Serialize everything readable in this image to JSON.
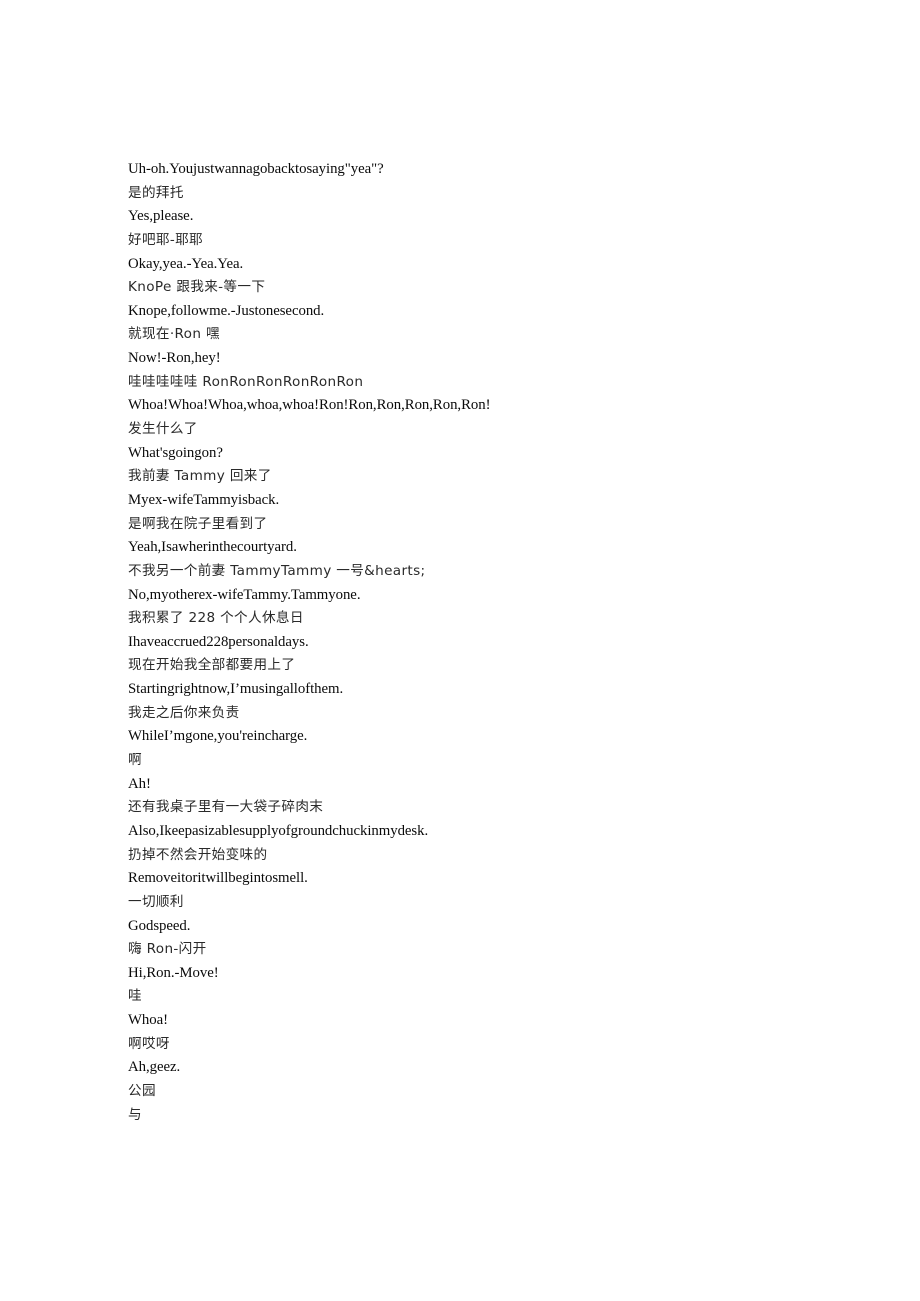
{
  "document": {
    "type": "bilingual-subtitle-transcript",
    "background_color": "#ffffff",
    "text_color": "#000000",
    "source_language": "zh",
    "target_language": "en"
  },
  "lines": [
    {
      "lang": "en",
      "text": "Uh-oh.Youjustwannagobacktosaying\"yea\"?"
    },
    {
      "lang": "zh",
      "text": "是的拜托"
    },
    {
      "lang": "en",
      "text": "Yes,please."
    },
    {
      "lang": "zh",
      "text": "好吧耶-耶耶"
    },
    {
      "lang": "en",
      "text": "Okay,yea.-Yea.Yea."
    },
    {
      "lang": "zh",
      "text": "KnoPe 跟我来-等一下"
    },
    {
      "lang": "en",
      "text": "Knope,followme.-Justonesecond."
    },
    {
      "lang": "zh",
      "text": "就现在·Ron 嘿"
    },
    {
      "lang": "en",
      "text": "Now!-Ron,hey!"
    },
    {
      "lang": "zh",
      "text": "哇哇哇哇哇 RonRonRonRonRonRon"
    },
    {
      "lang": "en",
      "text": "Whoa!Whoa!Whoa,whoa,whoa!Ron!Ron,Ron,Ron,Ron,Ron!"
    },
    {
      "lang": "zh",
      "text": "发生什么了"
    },
    {
      "lang": "en",
      "text": "What'sgoingon?"
    },
    {
      "lang": "zh",
      "text": "我前妻 Tammy 回来了"
    },
    {
      "lang": "en",
      "text": "Myex-wifeTammyisback."
    },
    {
      "lang": "zh",
      "text": "是啊我在院子里看到了"
    },
    {
      "lang": "en",
      "text": "Yeah,Isawherinthecourtyard."
    },
    {
      "lang": "zh",
      "text": "不我另一个前妻 TammyTammy 一号&hearts;"
    },
    {
      "lang": "en",
      "text": "No,myotherex-wifeTammy.Tammyone."
    },
    {
      "lang": "zh",
      "text": "我积累了 228 个个人休息日"
    },
    {
      "lang": "en",
      "text": "Ihaveaccrued228personaldays."
    },
    {
      "lang": "zh",
      "text": "现在开始我全部都要用上了"
    },
    {
      "lang": "en",
      "text": "Startingrightnow,I’musingallofthem."
    },
    {
      "lang": "zh",
      "text": "我走之后你来负责"
    },
    {
      "lang": "en",
      "text": "WhileI’mgone,you'reincharge."
    },
    {
      "lang": "zh",
      "text": "啊"
    },
    {
      "lang": "en",
      "text": "Ah!"
    },
    {
      "lang": "zh",
      "text": "还有我桌子里有一大袋子碎肉末"
    },
    {
      "lang": "en",
      "text": "Also,Ikeepasizablesupplyofgroundchuckinmydesk."
    },
    {
      "lang": "zh",
      "text": "扔掉不然会开始变味的"
    },
    {
      "lang": "en",
      "text": "Removeitoritwillbegintosmell."
    },
    {
      "lang": "zh",
      "text": "一切顺利"
    },
    {
      "lang": "en",
      "text": "Godspeed."
    },
    {
      "lang": "zh",
      "text": "嗨 Ron-闪开"
    },
    {
      "lang": "en",
      "text": "Hi,Ron.-Move!"
    },
    {
      "lang": "zh",
      "text": "哇"
    },
    {
      "lang": "en",
      "text": "Whoa!"
    },
    {
      "lang": "zh",
      "text": "啊哎呀"
    },
    {
      "lang": "en",
      "text": "Ah,geez."
    },
    {
      "lang": "zh",
      "text": "公园"
    },
    {
      "lang": "zh",
      "text": "与"
    }
  ]
}
